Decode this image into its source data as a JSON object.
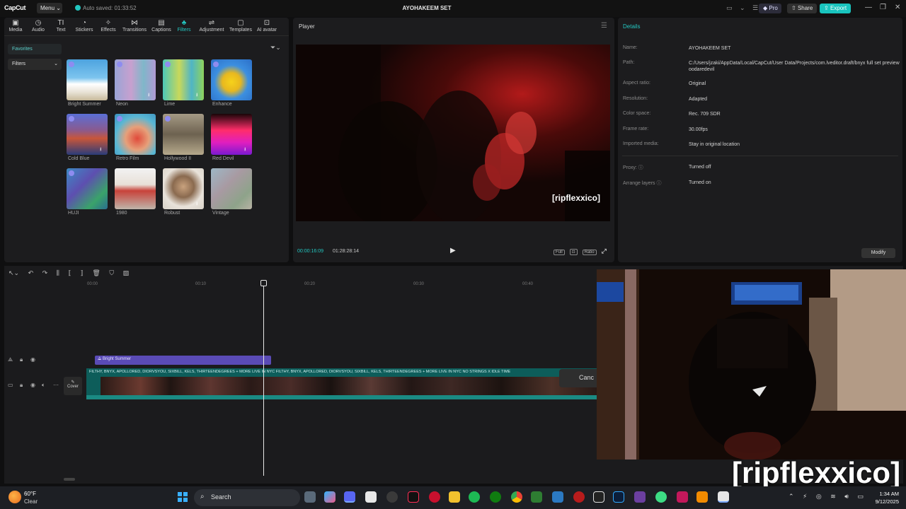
{
  "app": {
    "logo": "CapCut",
    "menu_label": "Menu",
    "autosave": "Auto saved: 01:33:52",
    "project_title": "AYOHAKEEM SET",
    "pro_label": "Pro",
    "share_label": "Share",
    "export_label": "Export"
  },
  "toolbar": {
    "items": [
      {
        "label": "Media",
        "icon": "media-icon"
      },
      {
        "label": "Audio",
        "icon": "audio-icon"
      },
      {
        "label": "Text",
        "icon": "text-icon"
      },
      {
        "label": "Stickers",
        "icon": "stickers-icon"
      },
      {
        "label": "Effects",
        "icon": "effects-icon"
      },
      {
        "label": "Transitions",
        "icon": "transitions-icon"
      },
      {
        "label": "Captions",
        "icon": "captions-icon"
      },
      {
        "label": "Filters",
        "icon": "filters-icon",
        "active": true
      },
      {
        "label": "Adjustment",
        "icon": "adjustment-icon"
      },
      {
        "label": "Templates",
        "icon": "templates-icon"
      },
      {
        "label": "AI avatar",
        "icon": "ai-avatar-icon"
      }
    ]
  },
  "filters_panel": {
    "favorites_label": "Favorites",
    "filters_dropdown": "Filters",
    "items": [
      {
        "label": "Bright Summer"
      },
      {
        "label": "Neon"
      },
      {
        "label": "Lime"
      },
      {
        "label": "Enhance"
      },
      {
        "label": "Cold Blue"
      },
      {
        "label": "Retro Film"
      },
      {
        "label": "Hollywood II"
      },
      {
        "label": "Red Devil"
      },
      {
        "label": "HUJI"
      },
      {
        "label": "1980"
      },
      {
        "label": "Robust"
      },
      {
        "label": "Vintage"
      }
    ]
  },
  "player": {
    "title": "Player",
    "current_time": "00:00:16:09",
    "total_time": "01:28:28:14",
    "watermark": "[ripflexxico]",
    "full_label": "Full",
    "ratio_label": "Ratio"
  },
  "details": {
    "title": "Details",
    "rows": [
      {
        "key": "Name:",
        "value": "AYOHAKEEM SET"
      },
      {
        "key": "Path:",
        "value": "C:/Users/jzaki/AppData/Local/CapCut/User Data/Projects/com.lveditor.draft/bnyx full set preview oodaredevil"
      },
      {
        "key": "Aspect ratio:",
        "value": "Original"
      },
      {
        "key": "Resolution:",
        "value": "Adapted"
      },
      {
        "key": "Color space:",
        "value": "Rec. 709 SDR"
      },
      {
        "key": "Frame rate:",
        "value": "30.00fps"
      },
      {
        "key": "Imported media:",
        "value": "Stay in original location"
      },
      {
        "key": "Proxy:",
        "value": "Turned off"
      },
      {
        "key": "Arrange layers",
        "value": "Turned on"
      }
    ],
    "modify_label": "Modify"
  },
  "timeline": {
    "ticks": [
      "00:00",
      "00:10",
      "00:20",
      "00:30",
      "00:40"
    ],
    "filter_clip": "Bright Summer",
    "main_clip_label": "FILTHY, BNYX, APOLLORED, DIORVSYOU, SIXBILL, KELS, THIRTEENDEGREES + MORE LIVE IN NYC  FILTHY, BNYX, APOLLORED, DIORVSYOU, SIXBILL, KELS, THIRTEENDEGREES + MORE LIVE IN NYC  NO STRINGS X IDLE TIME",
    "cover_label": "Cover",
    "cancel_label": "Canc"
  },
  "overlay": {
    "watermark": "[ripflexxico]"
  },
  "taskbar": {
    "temp": "60°F",
    "condition": "Clear",
    "search_placeholder": "Search",
    "time": "1:34 AM",
    "date": "9/12/2025"
  },
  "colors": {
    "accent": "#24c7c1",
    "filter_clip": "#5a4bb6",
    "main_clip": "#0d5d5a"
  }
}
